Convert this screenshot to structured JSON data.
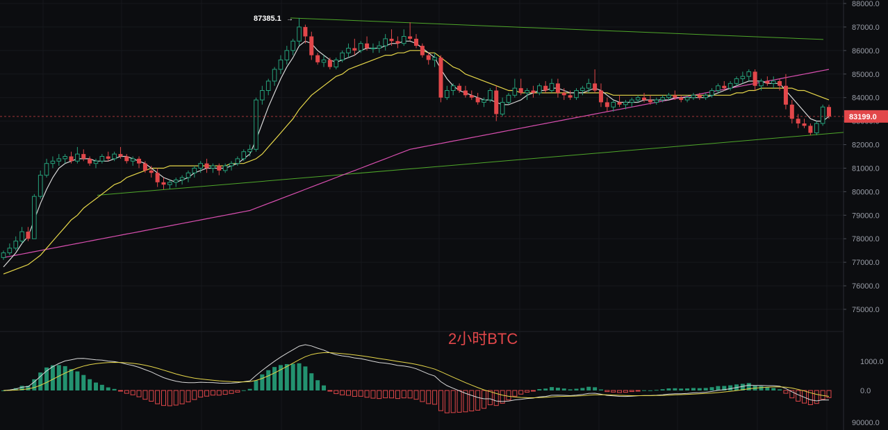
{
  "chart_data": [
    {
      "type": "candlestick",
      "title": "2小时BTC",
      "ylim": [
        74500,
        88000
      ],
      "y_ticks": [
        "88000.0",
        "87000.0",
        "86000.0",
        "85000.0",
        "84000.0",
        "83000.0",
        "82000.0",
        "81000.0",
        "80000.0",
        "79000.0",
        "78000.0",
        "77000.0",
        "76000.0",
        "75000.0"
      ],
      "last_price_label": "83199.0",
      "high_label": "87385.1",
      "colors": {
        "up": "#26a17b",
        "down": "#e2474a",
        "ma_fast": "#d9d9d9",
        "ma_mid": "#e8d84a",
        "ma_slow": "#d94fb0",
        "trend": "#4fa82a"
      },
      "candles": [
        [
          77200,
          77500,
          77100,
          77400
        ],
        [
          77400,
          77800,
          77300,
          77600
        ],
        [
          77600,
          78100,
          77500,
          77900
        ],
        [
          77900,
          78500,
          77800,
          78300
        ],
        [
          78300,
          78500,
          77900,
          78000
        ],
        [
          78000,
          79900,
          78000,
          79800
        ],
        [
          79800,
          80900,
          79700,
          80700
        ],
        [
          80700,
          81400,
          80600,
          81200
        ],
        [
          81200,
          81500,
          81000,
          81300
        ],
        [
          81300,
          81600,
          81100,
          81400
        ],
        [
          81400,
          81600,
          81200,
          81500
        ],
        [
          81500,
          81700,
          81200,
          81300
        ],
        [
          81300,
          81900,
          81200,
          81600
        ],
        [
          81600,
          81800,
          81300,
          81400
        ],
        [
          81400,
          81500,
          81100,
          81200
        ],
        [
          81200,
          81400,
          81000,
          81300
        ],
        [
          81300,
          81600,
          81200,
          81500
        ],
        [
          81500,
          81700,
          81300,
          81400
        ],
        [
          81400,
          81700,
          81300,
          81600
        ],
        [
          81600,
          81900,
          81400,
          81500
        ],
        [
          81500,
          81600,
          81200,
          81300
        ],
        [
          81300,
          81500,
          81100,
          81400
        ],
        [
          81400,
          81500,
          81000,
          81200
        ],
        [
          81200,
          81300,
          80800,
          80900
        ],
        [
          80900,
          81100,
          80600,
          80800
        ],
        [
          80800,
          81000,
          80200,
          80400
        ],
        [
          80400,
          80600,
          80100,
          80300
        ],
        [
          80300,
          80500,
          80100,
          80400
        ],
        [
          80400,
          80600,
          80200,
          80500
        ],
        [
          80500,
          80700,
          80300,
          80600
        ],
        [
          80600,
          80900,
          80400,
          80800
        ],
        [
          80800,
          81100,
          80600,
          81000
        ],
        [
          81000,
          81300,
          80800,
          81200
        ],
        [
          81200,
          81400,
          80800,
          81000
        ],
        [
          81000,
          81200,
          80800,
          81100
        ],
        [
          81100,
          81200,
          80700,
          80900
        ],
        [
          80900,
          81200,
          80800,
          81100
        ],
        [
          81100,
          81300,
          80900,
          81200
        ],
        [
          81200,
          81500,
          81100,
          81400
        ],
        [
          81400,
          81800,
          81300,
          81700
        ],
        [
          81700,
          82000,
          81500,
          81800
        ],
        [
          81800,
          84000,
          81700,
          83900
        ],
        [
          83900,
          84500,
          83700,
          84300
        ],
        [
          84300,
          84800,
          84100,
          84700
        ],
        [
          84700,
          85300,
          84500,
          85200
        ],
        [
          85200,
          85800,
          85000,
          85600
        ],
        [
          85600,
          86200,
          85400,
          86000
        ],
        [
          86000,
          86500,
          85800,
          86400
        ],
        [
          86400,
          87385,
          86200,
          87000
        ],
        [
          87000,
          87100,
          86300,
          86600
        ],
        [
          86600,
          86800,
          85600,
          85800
        ],
        [
          85800,
          85900,
          85400,
          85500
        ],
        [
          85500,
          85800,
          85300,
          85600
        ],
        [
          85600,
          85700,
          85200,
          85300
        ],
        [
          85300,
          85700,
          85200,
          85600
        ],
        [
          85600,
          86000,
          85500,
          85900
        ],
        [
          85900,
          86300,
          85700,
          86100
        ],
        [
          86100,
          86500,
          85800,
          86000
        ],
        [
          86000,
          86400,
          85900,
          86300
        ],
        [
          86300,
          86600,
          86000,
          86100
        ],
        [
          86100,
          86300,
          85900,
          86100
        ],
        [
          86100,
          86400,
          85900,
          86200
        ],
        [
          86200,
          86700,
          86000,
          86500
        ],
        [
          86500,
          86900,
          86200,
          86400
        ],
        [
          86400,
          86600,
          86100,
          86300
        ],
        [
          86300,
          86900,
          86200,
          86600
        ],
        [
          86600,
          87200,
          86400,
          86500
        ],
        [
          86500,
          86700,
          86100,
          86200
        ],
        [
          86200,
          86300,
          85700,
          85800
        ],
        [
          85800,
          85900,
          85400,
          85600
        ],
        [
          85600,
          85900,
          85300,
          85700
        ],
        [
          85700,
          85800,
          83800,
          84000
        ],
        [
          84000,
          84500,
          83900,
          84300
        ],
        [
          84300,
          84600,
          84100,
          84500
        ],
        [
          84500,
          84600,
          84200,
          84300
        ],
        [
          84300,
          84500,
          84000,
          84100
        ],
        [
          84100,
          84300,
          83900,
          84000
        ],
        [
          84000,
          84200,
          83700,
          83800
        ],
        [
          83800,
          84000,
          83600,
          83900
        ],
        [
          83900,
          84400,
          83800,
          84300
        ],
        [
          84300,
          84500,
          83000,
          83300
        ],
        [
          83300,
          84000,
          83200,
          83800
        ],
        [
          83800,
          84200,
          83700,
          84100
        ],
        [
          84100,
          84800,
          84000,
          84400
        ],
        [
          84400,
          84800,
          84100,
          84200
        ],
        [
          84200,
          84400,
          83900,
          84300
        ],
        [
          84300,
          84500,
          84000,
          84200
        ],
        [
          84200,
          84600,
          84100,
          84500
        ],
        [
          84500,
          84700,
          84200,
          84300
        ],
        [
          84300,
          84800,
          84200,
          84600
        ],
        [
          84600,
          84800,
          84000,
          84200
        ],
        [
          84200,
          84400,
          83900,
          84100
        ],
        [
          84100,
          84300,
          83900,
          84000
        ],
        [
          84000,
          84400,
          83900,
          84300
        ],
        [
          84300,
          84500,
          84100,
          84400
        ],
        [
          84400,
          84800,
          84200,
          84600
        ],
        [
          84600,
          85200,
          84200,
          84300
        ],
        [
          84300,
          84600,
          83600,
          83800
        ],
        [
          83800,
          84000,
          83400,
          83600
        ],
        [
          83600,
          83900,
          83400,
          83800
        ],
        [
          83800,
          84100,
          83600,
          83700
        ],
        [
          83700,
          83900,
          83500,
          83800
        ],
        [
          83800,
          84000,
          83600,
          83900
        ],
        [
          83900,
          84100,
          83800,
          84000
        ],
        [
          84000,
          84200,
          83800,
          83900
        ],
        [
          83900,
          84100,
          83700,
          83800
        ],
        [
          83800,
          84000,
          83700,
          83900
        ],
        [
          83900,
          84100,
          83800,
          84000
        ],
        [
          84000,
          84200,
          83900,
          84100
        ],
        [
          84100,
          84300,
          83900,
          84000
        ],
        [
          84000,
          84100,
          83800,
          83900
        ],
        [
          83900,
          84100,
          83800,
          84000
        ],
        [
          84000,
          84200,
          83900,
          84100
        ],
        [
          84100,
          84200,
          83900,
          84000
        ],
        [
          84000,
          84200,
          83900,
          84100
        ],
        [
          84100,
          84400,
          84000,
          84300
        ],
        [
          84300,
          84600,
          84200,
          84500
        ],
        [
          84500,
          84700,
          84300,
          84400
        ],
        [
          84400,
          84700,
          84300,
          84600
        ],
        [
          84600,
          84900,
          84500,
          84800
        ],
        [
          84800,
          85100,
          84600,
          84900
        ],
        [
          84900,
          85200,
          84700,
          85100
        ],
        [
          85100,
          85200,
          84300,
          84500
        ],
        [
          84500,
          84800,
          84300,
          84700
        ],
        [
          84700,
          84900,
          84500,
          84600
        ],
        [
          84600,
          84900,
          84400,
          84700
        ],
        [
          84700,
          84800,
          84300,
          84500
        ],
        [
          84500,
          85000,
          83500,
          83700
        ],
        [
          83700,
          83900,
          82900,
          83100
        ],
        [
          83100,
          83300,
          82700,
          82900
        ],
        [
          82900,
          83100,
          82700,
          82800
        ],
        [
          82800,
          82900,
          82400,
          82500
        ],
        [
          82500,
          83000,
          82400,
          82900
        ],
        [
          82900,
          83700,
          82800,
          83600
        ],
        [
          83600,
          83700,
          83100,
          83199
        ]
      ],
      "ma_fast": [
        76800,
        77100,
        77400,
        77800,
        78100,
        78800,
        79500,
        80100,
        80600,
        81000,
        81200,
        81300,
        81400,
        81400,
        81400,
        81300,
        81300,
        81300,
        81400,
        81500,
        81500,
        81400,
        81300,
        81200,
        81000,
        80800,
        80600,
        80500,
        80400,
        80500,
        80600,
        80800,
        80900,
        81000,
        81000,
        81000,
        81000,
        81100,
        81200,
        81400,
        81600,
        82200,
        82900,
        83600,
        84200,
        84800,
        85300,
        85700,
        86200,
        86400,
        86300,
        86000,
        85800,
        85600,
        85500,
        85600,
        85700,
        85800,
        86000,
        86100,
        86100,
        86100,
        86200,
        86300,
        86300,
        86400,
        86400,
        86300,
        86100,
        85900,
        85700,
        85200,
        84800,
        84500,
        84300,
        84200,
        84100,
        84000,
        83900,
        83900,
        83800,
        83700,
        83700,
        83800,
        83900,
        84100,
        84200,
        84300,
        84300,
        84400,
        84400,
        84300,
        84200,
        84200,
        84200,
        84300,
        84400,
        84300,
        84100,
        83900,
        83800,
        83800,
        83800,
        83800,
        83900,
        83900,
        83900,
        83900,
        83900,
        84000,
        84000,
        84000,
        84000,
        84000,
        84000,
        84100,
        84200,
        84300,
        84400,
        84500,
        84600,
        84700,
        84700,
        84700,
        84600,
        84600,
        84600,
        84300,
        84000,
        83700,
        83400,
        83100,
        83000,
        83000,
        83200
      ],
      "ma_mid": [
        76500,
        76600,
        76700,
        76800,
        76900,
        77100,
        77300,
        77600,
        77900,
        78200,
        78500,
        78800,
        79000,
        79300,
        79500,
        79700,
        79900,
        80100,
        80300,
        80400,
        80600,
        80700,
        80800,
        80900,
        81000,
        81000,
        81000,
        81100,
        81100,
        81100,
        81100,
        81100,
        81100,
        81100,
        81100,
        81100,
        81100,
        81200,
        81200,
        81200,
        81300,
        81400,
        81600,
        81900,
        82200,
        82500,
        82800,
        83100,
        83500,
        83800,
        84100,
        84300,
        84500,
        84700,
        84900,
        85000,
        85200,
        85300,
        85400,
        85500,
        85600,
        85700,
        85800,
        85800,
        85900,
        85900,
        86000,
        86000,
        86000,
        85900,
        85900,
        85700,
        85500,
        85300,
        85200,
        85000,
        84900,
        84800,
        84700,
        84600,
        84500,
        84400,
        84300,
        84300,
        84200,
        84200,
        84200,
        84200,
        84200,
        84200,
        84200,
        84200,
        84200,
        84200,
        84200,
        84200,
        84200,
        84200,
        84200,
        84100,
        84100,
        84100,
        84100,
        84100,
        84100,
        84100,
        84100,
        84100,
        84100,
        84100,
        84100,
        84100,
        84100,
        84100,
        84100,
        84100,
        84100,
        84100,
        84100,
        84200,
        84200,
        84300,
        84300,
        84400,
        84400,
        84400,
        84400,
        84400,
        84400,
        84300,
        84300,
        84200,
        84100,
        84000,
        83900
      ],
      "ma_slow": [
        77200,
        77250,
        77300,
        77350,
        77400,
        77450,
        77500,
        77550,
        77600,
        77650,
        77700,
        77750,
        77800,
        77850,
        77900,
        77950,
        78000,
        78050,
        78100,
        78150,
        78200,
        78250,
        78300,
        78350,
        78400,
        78450,
        78500,
        78550,
        78600,
        78650,
        78700,
        78750,
        78800,
        78850,
        78900,
        78950,
        79000,
        79050,
        79100,
        79150,
        79200,
        79300,
        79400,
        79500,
        79600,
        79700,
        79800,
        79900,
        80000,
        80100,
        80200,
        80300,
        80400,
        80500,
        80600,
        80700,
        80800,
        80900,
        81000,
        81100,
        81200,
        81300,
        81400,
        81500,
        81600,
        81700,
        81800,
        81850,
        81900,
        81950,
        82000,
        82050,
        82100,
        82150,
        82200,
        82250,
        82300,
        82350,
        82400,
        82450,
        82500,
        82550,
        82600,
        82650,
        82700,
        82750,
        82800,
        82850,
        82900,
        82950,
        83000,
        83050,
        83100,
        83150,
        83200,
        83250,
        83300,
        83350,
        83400,
        83450,
        83500,
        83550,
        83600,
        83650,
        83700,
        83750,
        83800,
        83850,
        83900,
        83950,
        84000,
        84050,
        84100,
        84150,
        84200,
        84250,
        84300,
        84350,
        84400,
        84450,
        84500,
        84550,
        84600,
        84650,
        84700,
        84750,
        84800,
        84850,
        84900,
        84950,
        85000,
        85050,
        85100,
        85150,
        85200
      ],
      "trendlines": [
        {
          "from": [
            418,
            87385
          ],
          "to": [
            1185,
            86470
          ]
        },
        {
          "from": [
            140,
            79850
          ],
          "to": [
            1214,
            82520
          ]
        }
      ]
    },
    {
      "type": "macd-histogram",
      "y_ticks": [
        "1000.0",
        "0.0",
        "90000.0"
      ],
      "ylim": [
        -1150,
        1350
      ]
    }
  ]
}
